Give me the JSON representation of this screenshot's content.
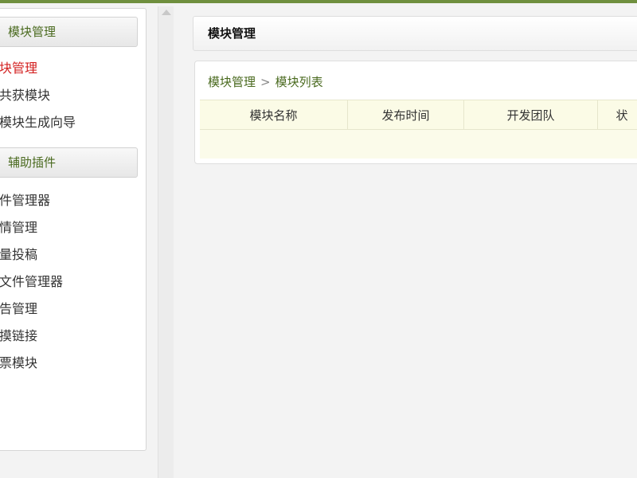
{
  "sidebar": {
    "group1_title": "模块管理",
    "group1_items": [
      "块管理",
      "共获模块",
      "模块生成向导"
    ],
    "group2_title": "辅助插件",
    "group2_items": [
      "件管理器",
      "情管理",
      "量投稿",
      "文件管理器",
      "告管理",
      "摸链接",
      "票模块"
    ]
  },
  "main": {
    "title": "模块管理",
    "breadcrumb": {
      "crumb1": "模块管理",
      "separator": ">",
      "crumb2": "模块列表"
    },
    "table": {
      "columns": [
        "模块名称",
        "发布时间",
        "开发团队",
        "状"
      ]
    }
  },
  "colors": {
    "accent_green": "#4a6a1f",
    "active_red": "#d32020",
    "table_header_bg": "#fbfbe6"
  }
}
